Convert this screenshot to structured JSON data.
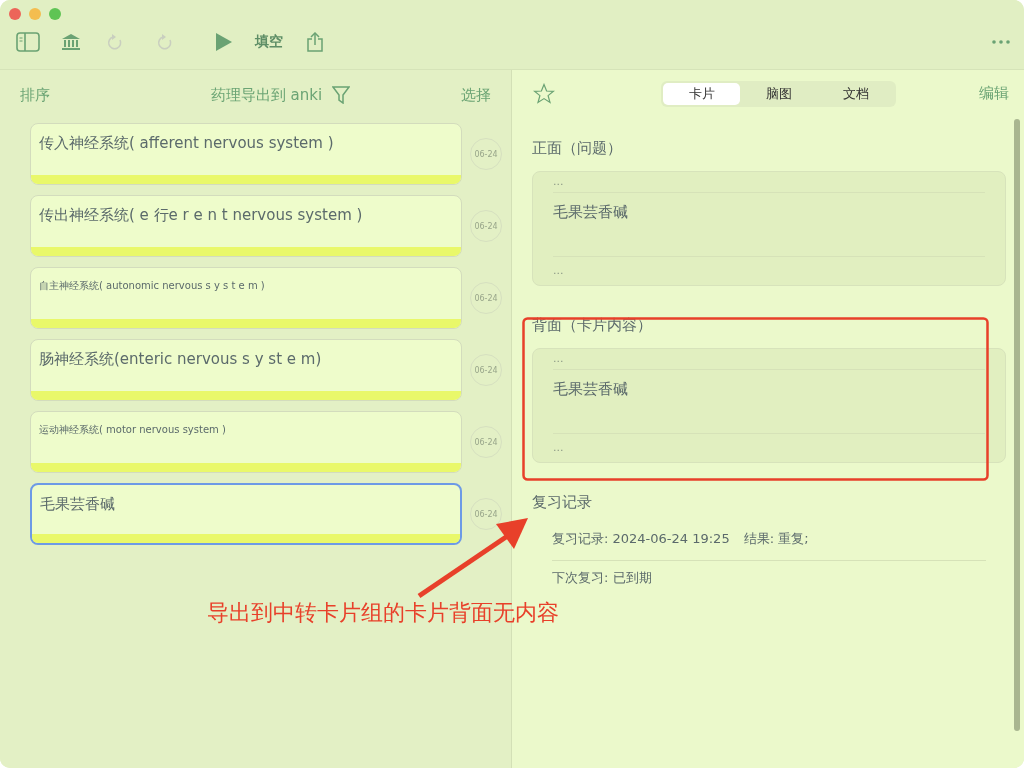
{
  "toolbar": {
    "undo": {
      "disabled": true
    },
    "redo": {
      "disabled": true
    },
    "fill_blank": "填空"
  },
  "list_header": {
    "sort": "排序",
    "title": "药理导出到 anki",
    "select": "选择"
  },
  "cards": [
    {
      "text": "传入神经系统( afferent nervous system )",
      "date": "06-24",
      "kind": "normal",
      "selected": false
    },
    {
      "text": "传出神经系统( e 行e r e n t nervous system )",
      "date": "06-24",
      "kind": "normal",
      "selected": false
    },
    {
      "text": "自主神经系统( autonomic nervous s y s t e m )",
      "date": "06-24",
      "kind": "small",
      "selected": false
    },
    {
      "text": "肠神经系统(enteric nervous s y st e m)",
      "date": "06-24",
      "kind": "normal",
      "selected": false
    },
    {
      "text": "运动神经系统( motor nervous system )",
      "date": "06-24",
      "kind": "small",
      "selected": false
    },
    {
      "text": "毛果芸香碱",
      "date": "06-24",
      "kind": "normal",
      "selected": true
    }
  ],
  "detail": {
    "starred": false,
    "tabs": [
      {
        "label": "卡片",
        "selected": true
      },
      {
        "label": "脑图",
        "selected": false
      },
      {
        "label": "文档",
        "selected": false
      }
    ],
    "edit": "编辑",
    "sections": [
      {
        "title": "正面（问题）",
        "top_marker": "...",
        "content": "毛果芸香碱",
        "bottom_marker": "..."
      },
      {
        "title": "背面（卡片内容）",
        "top_marker": "...",
        "content": "毛果芸香碱",
        "bottom_marker": "..."
      }
    ],
    "review": {
      "title": "复习记录",
      "record": "复习记录: 2024-06-24 19:25",
      "result": "结果: 重复;",
      "next": "下次复习: 已到期"
    }
  },
  "annotation": {
    "note": "导出到中转卡片组的卡片背面无内容"
  }
}
